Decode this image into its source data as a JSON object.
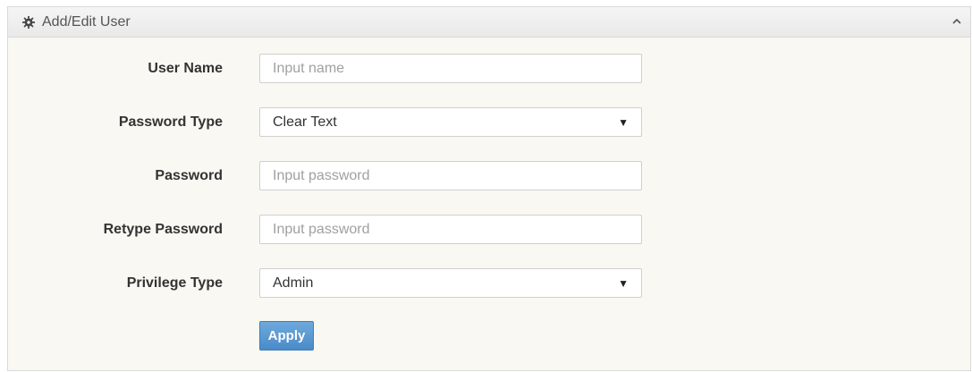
{
  "panel": {
    "title": "Add/Edit User",
    "icons": {
      "header": "gear-icon",
      "collapse": "chevron-up-icon"
    }
  },
  "form": {
    "user_name": {
      "label": "User Name",
      "placeholder": "Input name",
      "value": ""
    },
    "password_type": {
      "label": "Password Type",
      "selected": "Clear Text"
    },
    "password": {
      "label": "Password",
      "placeholder": "Input password",
      "value": ""
    },
    "retype_password": {
      "label": "Retype Password",
      "placeholder": "Input password",
      "value": ""
    },
    "privilege_type": {
      "label": "Privilege Type",
      "selected": "Admin"
    },
    "apply_label": "Apply"
  },
  "colors": {
    "panel_bg": "#f9f8f2",
    "header_bg": "#eeeeee",
    "apply_button": "#5b9bd5"
  }
}
